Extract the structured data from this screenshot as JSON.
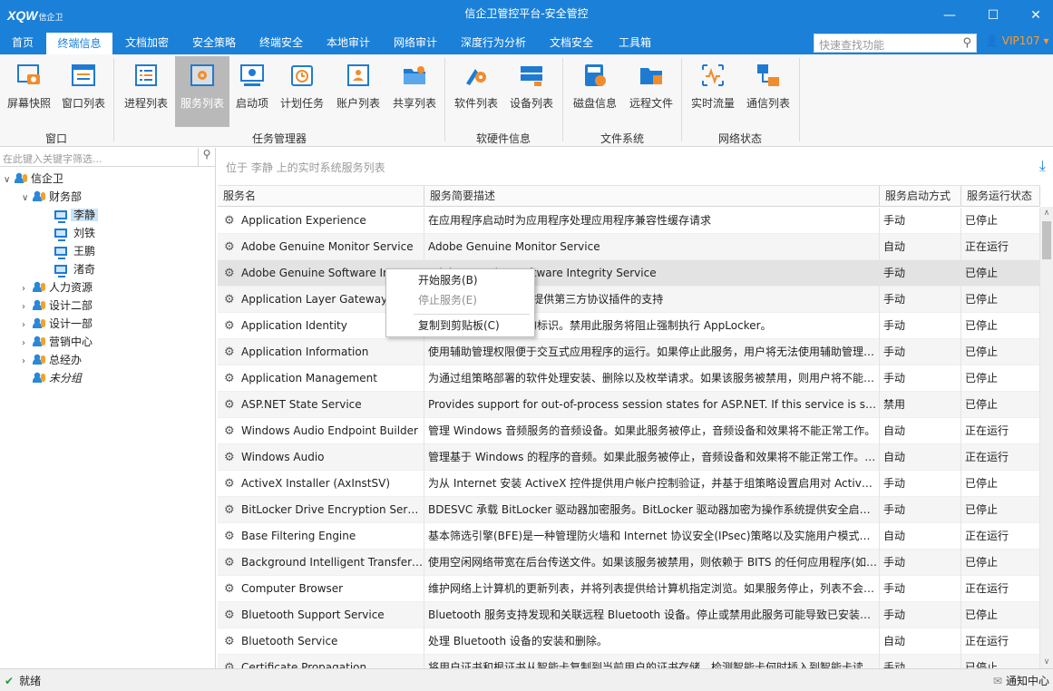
{
  "window": {
    "logo": "XQW",
    "logo_sub": "信企卫",
    "title": "信企卫管控平台-安全管控",
    "min": "—",
    "max": "☐",
    "close": "✕"
  },
  "menu": {
    "items": [
      "首页",
      "终端信息",
      "文档加密",
      "安全策略",
      "终端安全",
      "本地审计",
      "网络审计",
      "深度行为分析",
      "文档安全",
      "工具箱"
    ],
    "active": "终端信息",
    "quick_placeholder": "快速查找功能",
    "user": "VIP107"
  },
  "ribbon": {
    "groups": [
      {
        "label": "窗口",
        "buttons": [
          "屏幕快照",
          "窗口列表"
        ]
      },
      {
        "label": "任务管理器",
        "buttons": [
          "进程列表",
          "服务列表",
          "启动项",
          "计划任务",
          "账户列表",
          "共享列表"
        ]
      },
      {
        "label": "软硬件信息",
        "buttons": [
          "软件列表",
          "设备列表"
        ]
      },
      {
        "label": "文件系统",
        "buttons": [
          "磁盘信息",
          "远程文件"
        ]
      },
      {
        "label": "网络状态",
        "buttons": [
          "实时流量",
          "通信列表"
        ]
      }
    ],
    "selected": "服务列表"
  },
  "tree": {
    "search_placeholder": "在此键入关键字筛选...",
    "root": "信企卫",
    "dept": "财务部",
    "users": [
      "李静",
      "刘铁",
      "王鹏",
      "渚奇"
    ],
    "selected_user": "李静",
    "others": [
      "人力资源",
      "设计二部",
      "设计一部",
      "营销中心",
      "总经办"
    ],
    "ungrouped": "未分组"
  },
  "content": {
    "location": "位于 李静 上的实时系统服务列表",
    "columns": [
      "服务名",
      "服务简要描述",
      "服务启动方式",
      "服务运行状态"
    ],
    "rows": [
      [
        "Application Experience",
        "在应用程序启动时为应用程序处理应用程序兼容性缓存请求",
        "手动",
        "已停止"
      ],
      [
        "Adobe Genuine Monitor Service",
        "Adobe Genuine Monitor Service",
        "自动",
        "正在运行"
      ],
      [
        "Adobe Genuine Software Integrity Service",
        "Adobe Genuine Software Integrity Service",
        "手动",
        "已停止"
      ],
      [
        "Application Layer Gateway Service",
        "为 Internet 连接共享提供第三方协议插件的支持",
        "手动",
        "已停止"
      ],
      [
        "Application Identity",
        "确定并验证应用程序的标识。禁用此服务将阻止强制执行 AppLocker。",
        "手动",
        "已停止"
      ],
      [
        "Application Information",
        "使用辅助管理权限便于交互式应用程序的运行。如果停止此服务，用户将无法使用辅助管理员权限启动应用程序",
        "手动",
        "已停止"
      ],
      [
        "Application Management",
        "为通过组策略部署的软件处理安装、删除以及枚举请求。如果该服务被禁用，则用户将不能安装软件",
        "手动",
        "已停止"
      ],
      [
        "ASP.NET State Service",
        "Provides support for out-of-process session states for ASP.NET. If this service is stopped",
        "禁用",
        "已停止"
      ],
      [
        "Windows Audio Endpoint Builder",
        "管理 Windows 音频服务的音频设备。如果此服务被停止，音频设备和效果将不能正常工作。",
        "自动",
        "正在运行"
      ],
      [
        "Windows Audio",
        "管理基于 Windows 的程序的音频。如果此服务被停止，音频设备和效果将不能正常工作。如果此服务被禁用",
        "自动",
        "正在运行"
      ],
      [
        "ActiveX Installer (AxInstSV)",
        "为从 Internet 安装 ActiveX 控件提供用户帐户控制验证，并基于组策略设置启用对 ActiveX 控件安装的管理",
        "手动",
        "已停止"
      ],
      [
        "BitLocker Drive Encryption Service",
        "BDESVC 承载 BitLocker 驱动器加密服务。BitLocker 驱动器加密为操作系统提供安全启动保护",
        "手动",
        "已停止"
      ],
      [
        "Base Filtering Engine",
        "基本筛选引擎(BFE)是一种管理防火墙和 Internet 协议安全(IPsec)策略以及实施用户模式筛选的服务",
        "自动",
        "正在运行"
      ],
      [
        "Background Intelligent Transfer Service",
        "使用空闲网络带宽在后台传送文件。如果该服务被禁用，则依赖于 BITS 的任何应用程序(如 Windows Update)",
        "手动",
        "已停止"
      ],
      [
        "Computer Browser",
        "维护网络上计算机的更新列表，并将列表提供给计算机指定浏览。如果服务停止，列表不会被更新或维护",
        "手动",
        "正在运行"
      ],
      [
        "Bluetooth Support Service",
        "Bluetooth 服务支持发现和关联远程 Bluetooth 设备。停止或禁用此服务可能导致已安装的设备无法正常工作",
        "手动",
        "已停止"
      ],
      [
        "Bluetooth Service",
        "处理 Bluetooth 设备的安装和删除。",
        "自动",
        "正在运行"
      ],
      [
        "Certificate Propagation",
        "将用户证书和根证书从智能卡复制到当前用户的证书存储，检测智能卡何时插入到智能卡读卡器中",
        "手动",
        "已停止"
      ]
    ]
  },
  "context_menu": {
    "items": [
      "开始服务(B)",
      "停止服务(E)",
      "复制到剪贴板(C)"
    ]
  },
  "status": {
    "text": "就绪",
    "notify": "通知中心"
  }
}
